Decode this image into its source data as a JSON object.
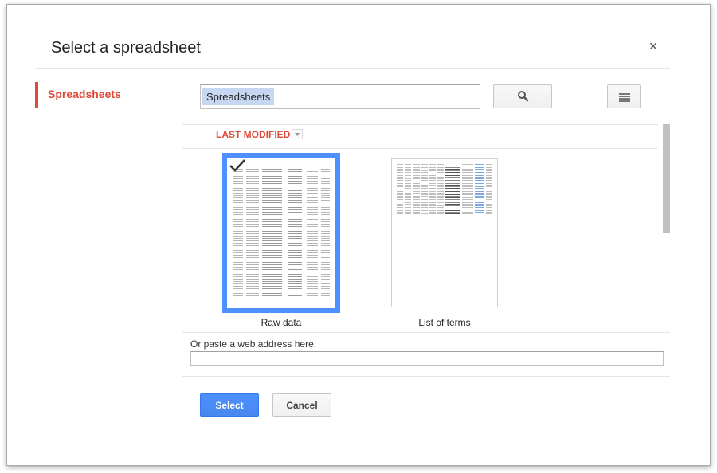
{
  "dialog": {
    "title": "Select a spreadsheet",
    "close_glyph": "×"
  },
  "nav": {
    "items": [
      {
        "label": "Spreadsheets",
        "selected": true
      }
    ]
  },
  "search": {
    "value": "Spreadsheets",
    "search_icon": "search-icon",
    "view_icon": "list-view-icon"
  },
  "sort": {
    "label": "LAST MODIFIED",
    "icon": "dropdown-arrow-icon"
  },
  "files": [
    {
      "name": "Raw data",
      "selected": true
    },
    {
      "name": "List of terms",
      "selected": false
    }
  ],
  "url": {
    "label": "Or paste a web address here:",
    "value": ""
  },
  "actions": {
    "select_label": "Select",
    "cancel_label": "Cancel"
  },
  "colors": {
    "accent_red": "#dd4b39",
    "select_blue": "#4d90fe",
    "highlight": "#c8d7f1"
  }
}
